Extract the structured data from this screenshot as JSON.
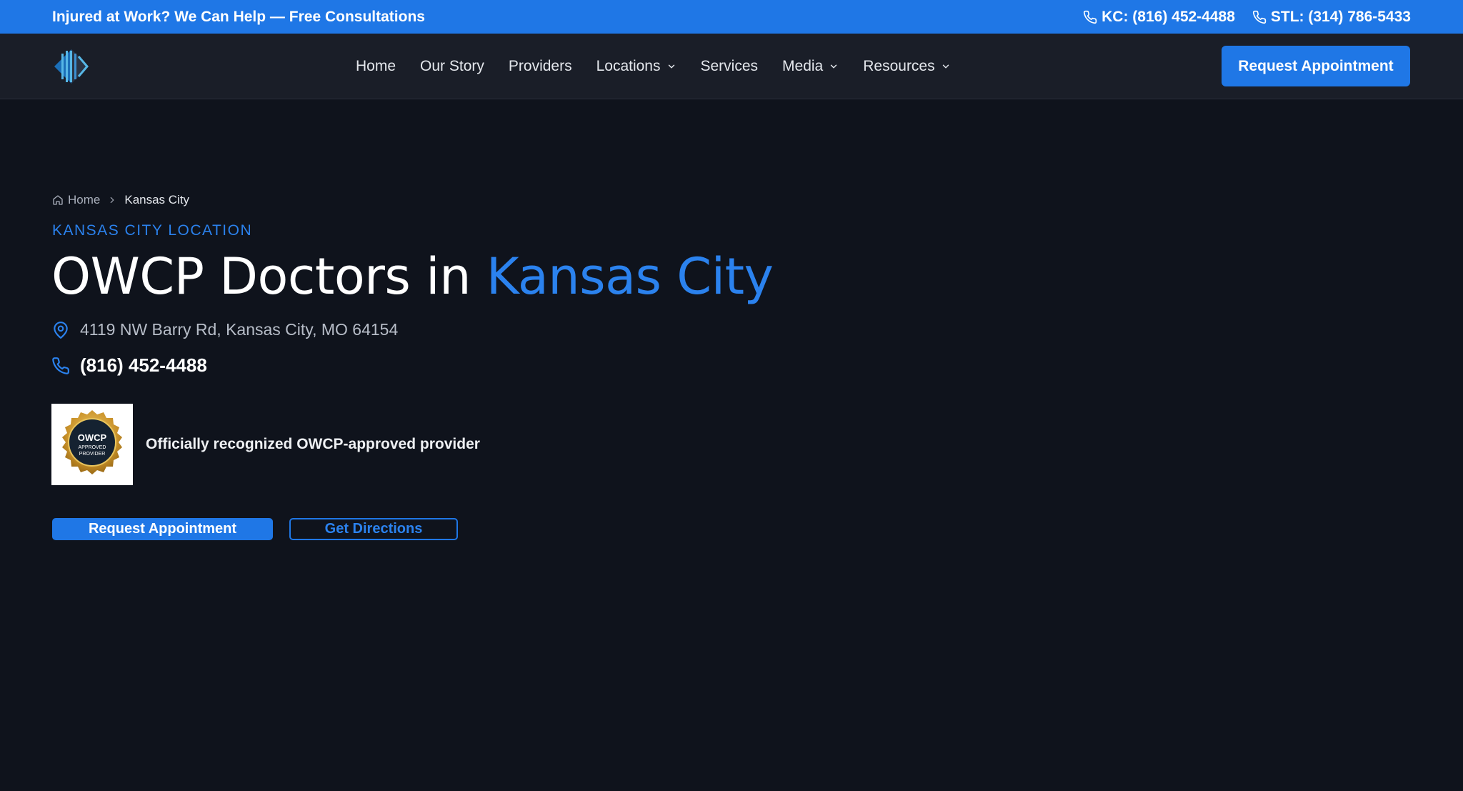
{
  "colors": {
    "brand_blue": "#1f77e6",
    "accent_text": "#2b82ee",
    "page_bg": "#0f131c",
    "nav_bg": "#1a1e28"
  },
  "topbar": {
    "message": "Injured at Work? We Can Help — Free Consultations",
    "phones": [
      {
        "label": "KC: (816) 452-4488",
        "icon": "phone-icon"
      },
      {
        "label": "STL: (314) 786-5433",
        "icon": "phone-icon"
      }
    ]
  },
  "nav": {
    "logo_icon": "logo-icon",
    "items": [
      {
        "label": "Home",
        "dropdown": false
      },
      {
        "label": "Our Story",
        "dropdown": false
      },
      {
        "label": "Providers",
        "dropdown": false
      },
      {
        "label": "Locations",
        "dropdown": true
      },
      {
        "label": "Services",
        "dropdown": false
      },
      {
        "label": "Media",
        "dropdown": true
      },
      {
        "label": "Resources",
        "dropdown": true
      }
    ],
    "cta_label": "Request Appointment"
  },
  "breadcrumb": {
    "home": "Home",
    "current": "Kansas City"
  },
  "hero": {
    "eyebrow": "KANSAS CITY LOCATION",
    "title_prefix": "OWCP Doctors in ",
    "title_accent": "Kansas City",
    "address": "4119 NW Barry Rd, Kansas City, MO 64154",
    "phone": "(816) 452-4488",
    "badge": {
      "seal_line1": "OWCP",
      "seal_line2": "APPROVED",
      "seal_line3": "PROVIDER",
      "caption": "Officially recognized OWCP-approved provider"
    },
    "primary_button": "Request Appointment",
    "secondary_button": "Get Directions"
  }
}
